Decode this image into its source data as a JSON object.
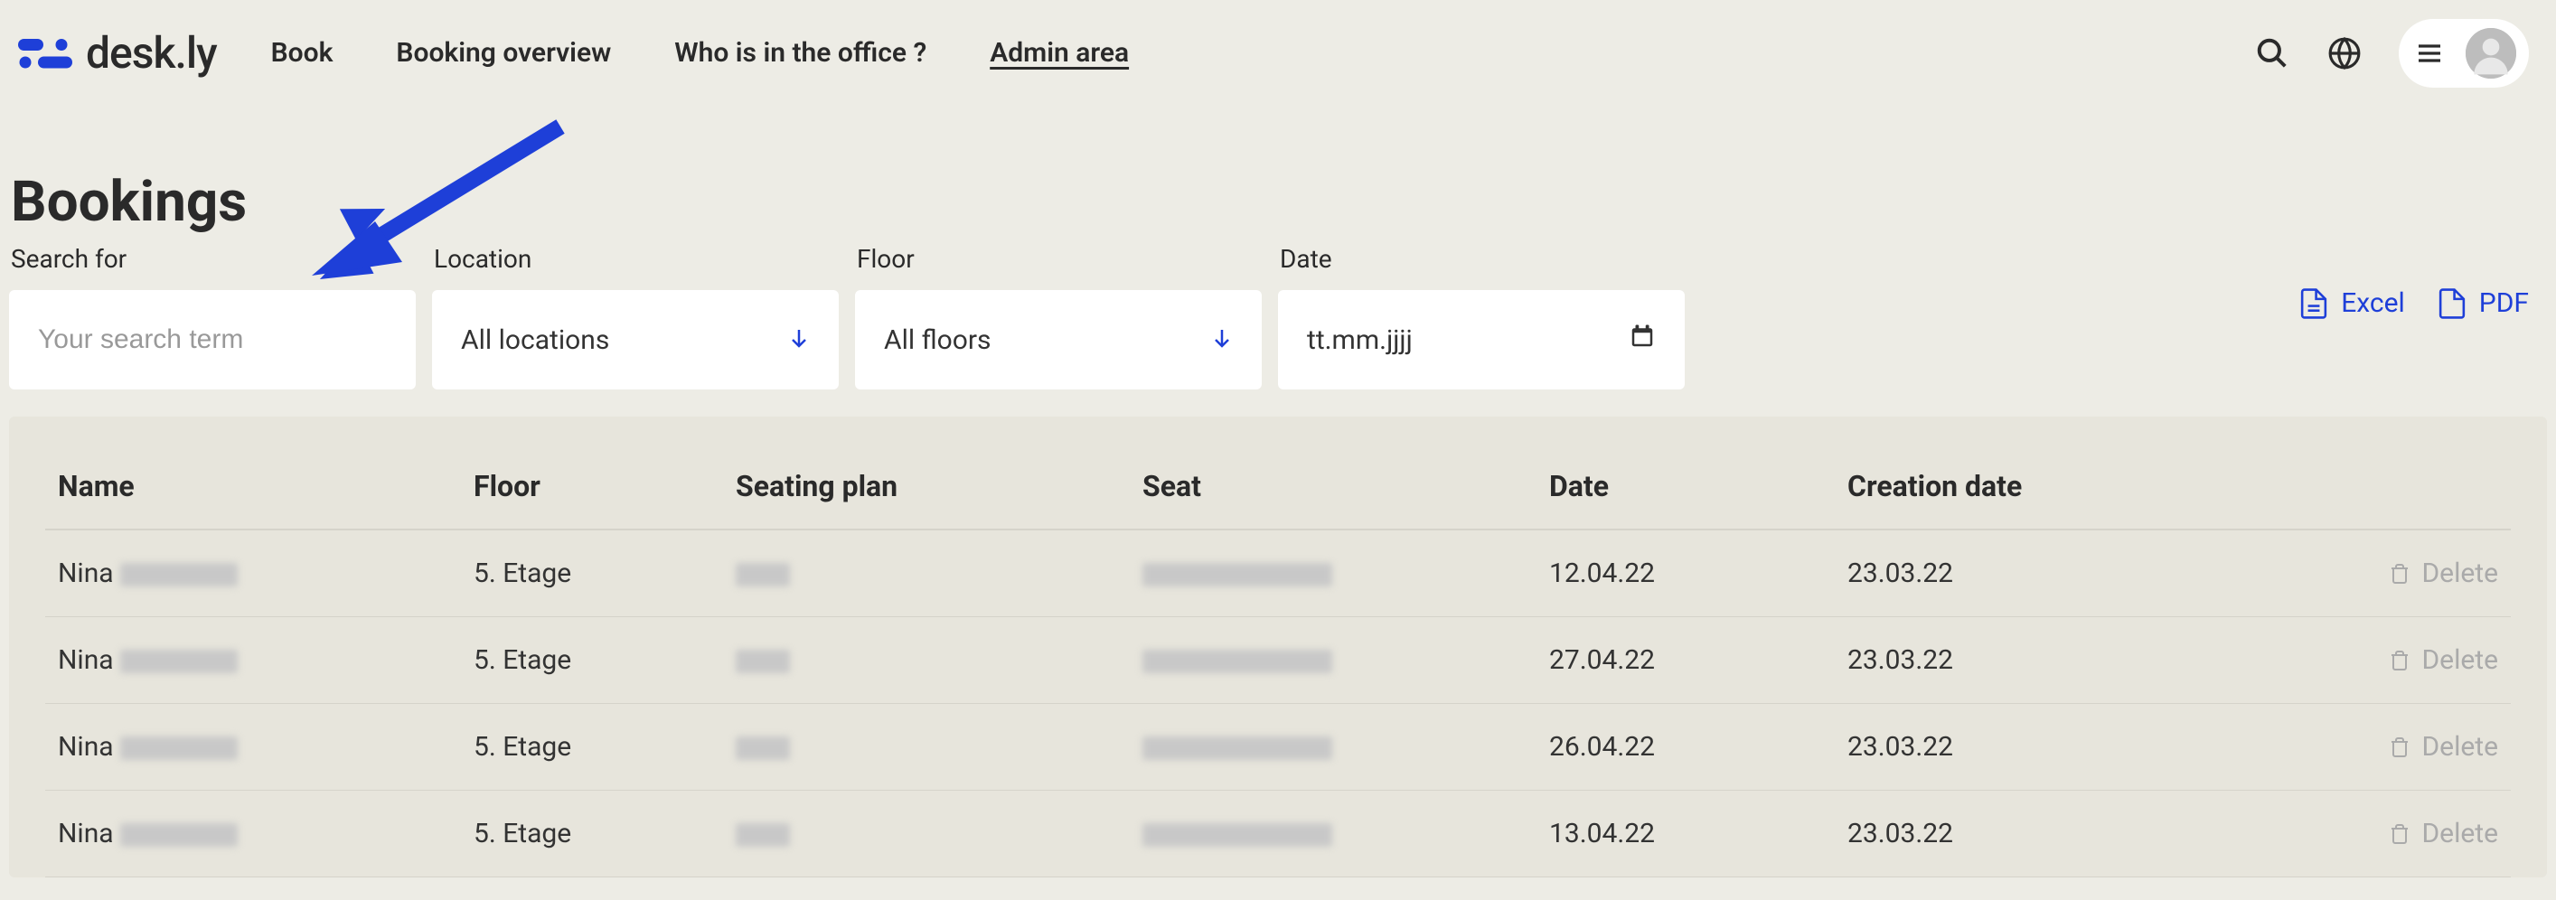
{
  "brand": "desk.ly",
  "nav": {
    "book": "Book",
    "booking_overview": "Booking overview",
    "who_office": "Who is in the office ?",
    "admin_area": "Admin area"
  },
  "page_title": "Bookings",
  "filters": {
    "search_label": "Search for",
    "search_placeholder": "Your search term",
    "location_label": "Location",
    "location_value": "All locations",
    "floor_label": "Floor",
    "floor_value": "All floors",
    "date_label": "Date",
    "date_placeholder": "tt.mm.jjjj"
  },
  "export": {
    "excel": "Excel",
    "pdf": "PDF"
  },
  "table": {
    "headers": {
      "name": "Name",
      "floor": "Floor",
      "seating_plan": "Seating plan",
      "seat": "Seat",
      "date": "Date",
      "creation_date": "Creation date"
    },
    "delete_label": "Delete",
    "rows": [
      {
        "name_first": "Nina",
        "floor": "5. Etage",
        "date": "12.04.22",
        "creation": "23.03.22"
      },
      {
        "name_first": "Nina",
        "floor": "5. Etage",
        "date": "27.04.22",
        "creation": "23.03.22"
      },
      {
        "name_first": "Nina",
        "floor": "5. Etage",
        "date": "26.04.22",
        "creation": "23.03.22"
      },
      {
        "name_first": "Nina",
        "floor": "5. Etage",
        "date": "13.04.22",
        "creation": "23.03.22"
      }
    ]
  }
}
